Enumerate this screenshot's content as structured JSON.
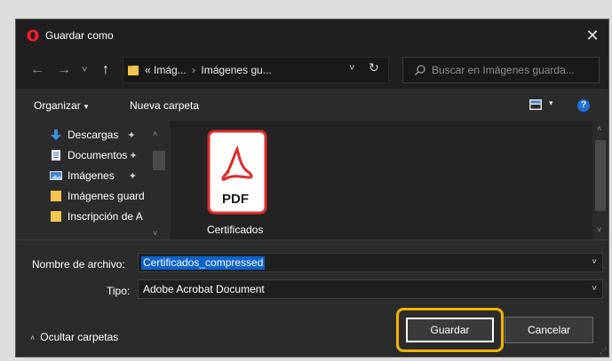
{
  "dialog": {
    "title": "Guardar como",
    "close_symbol": "✕"
  },
  "nav": {
    "back_symbol": "←",
    "forward_symbol": "→",
    "recent_symbol": "˅",
    "up_symbol": "↑",
    "breadcrumb_overflow": "«",
    "breadcrumb_1": "Imág...",
    "breadcrumb_sep": "›",
    "breadcrumb_2": "Imágenes gu...",
    "address_dropdown": "˅",
    "refresh_symbol": "↻",
    "search_placeholder": "Buscar en Imágenes guarda..."
  },
  "toolbar": {
    "organize_label": "Organizar",
    "organize_caret": "▾",
    "new_folder_label": "Nueva carpeta",
    "view_caret": "▾",
    "help_label": "?"
  },
  "sidebar": {
    "items": [
      {
        "label": "Descargas",
        "icon": "download-arrow-icon",
        "pinned": true
      },
      {
        "label": "Documentos",
        "icon": "document-icon",
        "pinned": true
      },
      {
        "label": "Imágenes",
        "icon": "pictures-icon",
        "pinned": true
      },
      {
        "label": "Imágenes guard",
        "icon": "folder-icon",
        "pinned": false
      },
      {
        "label": "Inscripción de A",
        "icon": "folder-icon",
        "pinned": false
      }
    ],
    "pin_symbol": "✦",
    "scroll_up": "˄",
    "scroll_down": "˅"
  },
  "files": [
    {
      "name": "Certificados",
      "type_badge": "PDF",
      "icon": "acrobat-pdf-icon"
    }
  ],
  "form": {
    "filename_label": "Nombre de archivo:",
    "filename_value": "Certificados_compressed",
    "type_label": "Tipo:",
    "type_value": "Adobe Acrobat Document",
    "dropdown_symbol": "˅"
  },
  "footer": {
    "hide_folders_chevron": "˄",
    "hide_folders_label": "Ocultar carpetas",
    "save_label": "Guardar",
    "cancel_label": "Cancelar"
  },
  "colors": {
    "dialog_bg": "#2b2b2b",
    "titlebar_bg": "#1f1f1f",
    "highlight_outline": "#f0b400",
    "selection_blue": "#0a63c9",
    "pdf_red": "#e02a2a",
    "folder_yellow": "#f5c451",
    "opera_red": "#ff1b2d"
  }
}
